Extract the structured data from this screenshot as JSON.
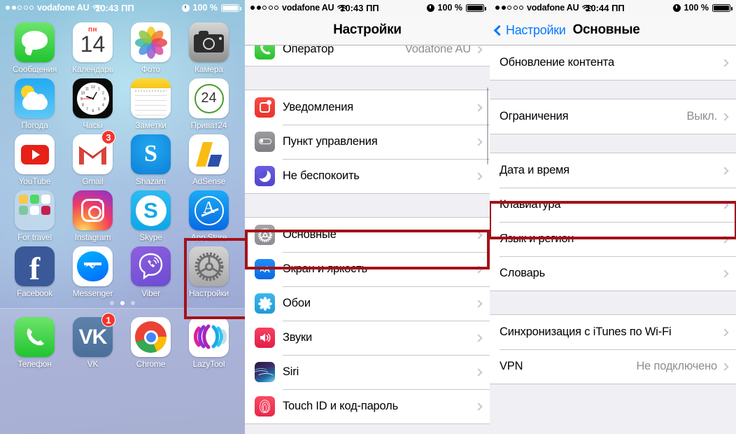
{
  "home": {
    "statusbar": {
      "signal_dots_filled": 2,
      "signal_dots_total": 5,
      "carrier": "vodafone AU",
      "time": "10:43 ПП",
      "battery_pct": "100 %"
    },
    "apps": [
      [
        {
          "name": "Сообщения",
          "icon": "messages-icon",
          "badge": null
        },
        {
          "name": "Календарь",
          "icon": "calendar-icon",
          "badge": null,
          "day": "пн",
          "date": "14"
        },
        {
          "name": "Фото",
          "icon": "photos-icon",
          "badge": null
        },
        {
          "name": "Камера",
          "icon": "camera-icon",
          "badge": null
        }
      ],
      [
        {
          "name": "Погода",
          "icon": "weather-icon",
          "badge": null
        },
        {
          "name": "Часы",
          "icon": "clock-icon",
          "badge": null
        },
        {
          "name": "Заметки",
          "icon": "notes-icon",
          "badge": null
        },
        {
          "name": "Приват24",
          "icon": "privat24-icon",
          "badge": null,
          "date": "24"
        }
      ],
      [
        {
          "name": "YouTube",
          "icon": "youtube-icon",
          "badge": null
        },
        {
          "name": "Gmail",
          "icon": "gmail-icon",
          "badge": "3"
        },
        {
          "name": "Shazam",
          "icon": "shazam-icon",
          "badge": null
        },
        {
          "name": "AdSense",
          "icon": "adsense-icon",
          "badge": null
        }
      ],
      [
        {
          "name": "For travel",
          "icon": "folder-icon",
          "badge": null
        },
        {
          "name": "Instagram",
          "icon": "instagram-icon",
          "badge": null
        },
        {
          "name": "Skype",
          "icon": "skype-icon",
          "badge": null
        },
        {
          "name": "App Store",
          "icon": "appstore-icon",
          "badge": null
        }
      ],
      [
        {
          "name": "Facebook",
          "icon": "facebook-icon",
          "badge": null
        },
        {
          "name": "Messenger",
          "icon": "messenger-icon",
          "badge": null
        },
        {
          "name": "Viber",
          "icon": "viber-icon",
          "badge": null
        },
        {
          "name": "Настройки",
          "icon": "settings-gear-icon",
          "badge": null,
          "highlighted": true
        }
      ]
    ],
    "page_dots": {
      "count": 3,
      "active_index": 1
    },
    "dock": [
      {
        "name": "Телефон",
        "icon": "phone-icon",
        "badge": null
      },
      {
        "name": "VK",
        "icon": "vk-icon",
        "badge": "1"
      },
      {
        "name": "Chrome",
        "icon": "chrome-icon",
        "badge": null
      },
      {
        "name": "LazyTool",
        "icon": "lazytool-icon",
        "badge": null
      }
    ],
    "highlight_color": "#a31219"
  },
  "settings": {
    "statusbar": {
      "carrier": "vodafone AU",
      "time": "10:43 ПП",
      "battery_pct": "100 %"
    },
    "title": "Настройки",
    "groups": [
      {
        "rows": [
          {
            "label": "Оператор",
            "value": "Vodafone AU",
            "icon": "phone-green-icon",
            "chevron": true,
            "partial": true
          }
        ]
      },
      {
        "rows": [
          {
            "label": "Уведомления",
            "value": "",
            "icon": "notifications-icon",
            "chevron": true
          },
          {
            "label": "Пункт управления",
            "value": "",
            "icon": "control-center-icon",
            "chevron": true
          },
          {
            "label": "Не беспокоить",
            "value": "",
            "icon": "do-not-disturb-icon",
            "chevron": true
          }
        ]
      },
      {
        "rows": [
          {
            "label": "Основные",
            "value": "",
            "icon": "general-gear-icon",
            "chevron": true,
            "highlighted": true
          },
          {
            "label": "Экран и яркость",
            "value": "",
            "icon": "display-brightness-icon",
            "chevron": true
          },
          {
            "label": "Обои",
            "value": "",
            "icon": "wallpaper-icon",
            "chevron": true
          },
          {
            "label": "Звуки",
            "value": "",
            "icon": "sounds-icon",
            "chevron": true
          },
          {
            "label": "Siri",
            "value": "",
            "icon": "siri-icon",
            "chevron": true
          },
          {
            "label": "Touch ID и код-пароль",
            "value": "",
            "icon": "touch-id-icon",
            "chevron": true
          }
        ]
      }
    ],
    "highlight_color": "#a31219"
  },
  "general": {
    "statusbar": {
      "carrier": "vodafone AU",
      "time": "10:44 ПП",
      "battery_pct": "100 %"
    },
    "back_label": "Настройки",
    "title": "Основные",
    "groups": [
      {
        "rows": [
          {
            "label": "Обновление контента",
            "value": "",
            "chevron": true
          }
        ]
      },
      {
        "rows": [
          {
            "label": "Ограничения",
            "value": "Выкл.",
            "chevron": true
          }
        ]
      },
      {
        "rows": [
          {
            "label": "Дата и время",
            "value": "",
            "chevron": true
          },
          {
            "label": "Клавиатура",
            "value": "",
            "chevron": true,
            "highlighted": true
          },
          {
            "label": "Язык и регион",
            "value": "",
            "chevron": true
          },
          {
            "label": "Словарь",
            "value": "",
            "chevron": true
          }
        ]
      },
      {
        "rows": [
          {
            "label": "Синхронизация с iTunes по Wi-Fi",
            "value": "",
            "chevron": true
          },
          {
            "label": "VPN",
            "value": "Не подключено",
            "chevron": true
          }
        ]
      }
    ],
    "highlight_color": "#a31219"
  }
}
